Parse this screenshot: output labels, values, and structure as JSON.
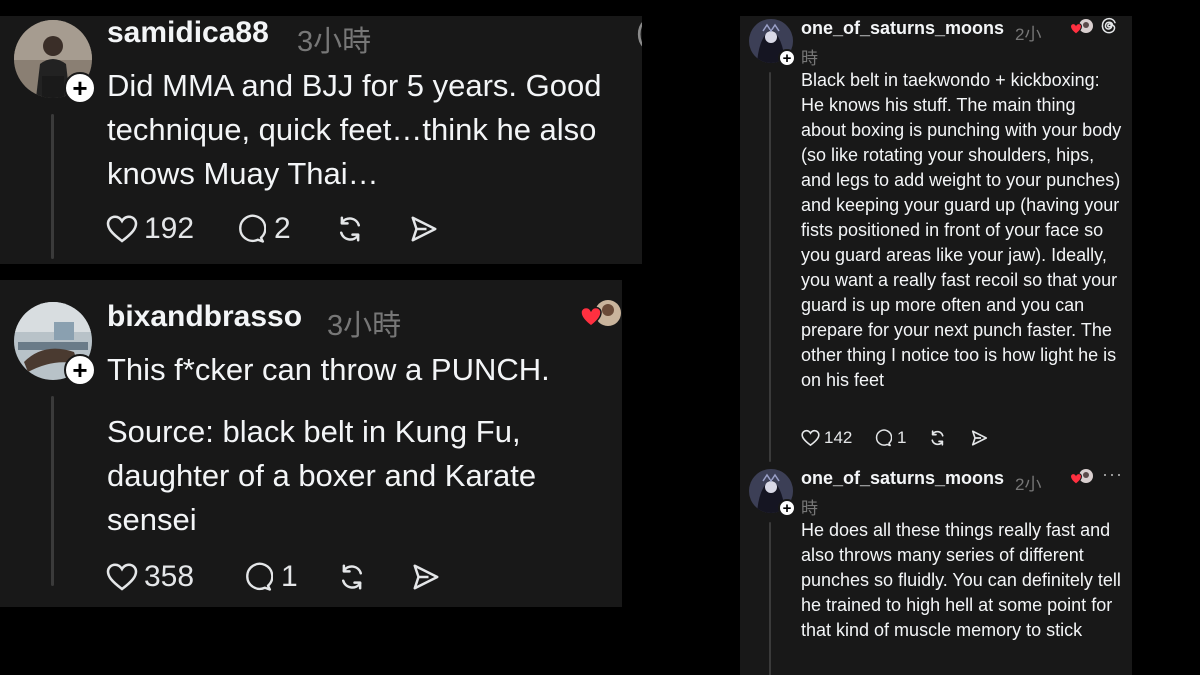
{
  "posts": [
    {
      "username": "samidica88",
      "time": "3小時",
      "text": "Did MMA and BJJ for 5 years. Good technique, quick feet…think he also knows Muay Thai…",
      "likes": "192",
      "replies": "2"
    },
    {
      "username": "bixandbrasso",
      "time": "3小時",
      "text": "This f*cker can throw a PUNCH.",
      "text2": "Source: black belt in Kung Fu, daughter of a boxer and Karate sensei",
      "likes": "358",
      "replies": "1"
    },
    {
      "username": "one_of_saturns_moons",
      "time_a": "2小",
      "time_b": "時",
      "text": "Black belt in taekwondo + kickboxing: He knows his stuff. The main thing about boxing is punching with your body (so like rotating your shoulders, hips, and legs to add weight to your punches) and keeping your guard up (having your fists positioned in front of your face so you guard areas like your jaw). Ideally, you want a really fast recoil so that your guard is up more often and you can prepare for your next punch faster. The other thing I notice too is how light he is on his feet",
      "likes": "142",
      "replies": "1"
    },
    {
      "username": "one_of_saturns_moons",
      "time_a": "2小",
      "time_b": "時",
      "text": "He does all these things really fast and also throws many series of different punches so fluidly. You can definitely tell he trained to high hell at some point for that kind of muscle memory to stick"
    }
  ],
  "colors": {
    "panel": "#181818",
    "heart_red": "#ff3040",
    "muted": "#777777"
  },
  "icons": [
    "heart-icon",
    "comment-icon",
    "repost-icon",
    "share-icon",
    "plus-icon",
    "threads-logo-icon",
    "more-icon"
  ]
}
